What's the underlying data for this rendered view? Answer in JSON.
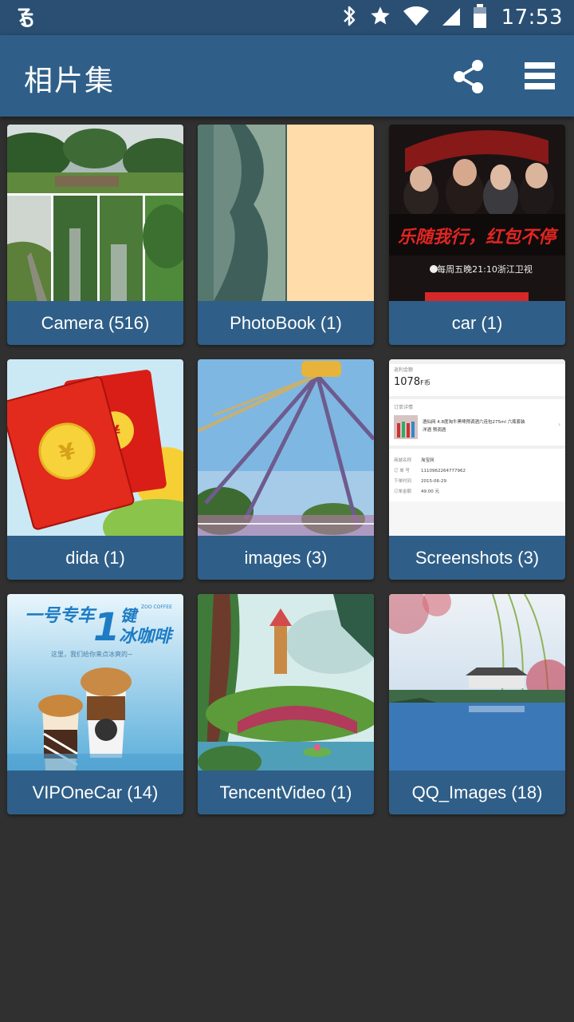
{
  "status_bar": {
    "time": "17:53",
    "icons": [
      "app-notification-icon",
      "bluetooth-icon",
      "star-icon",
      "wifi-icon",
      "signal-icon",
      "battery-icon"
    ]
  },
  "app_bar": {
    "title": "相片集",
    "actions": [
      "share-icon",
      "list-view-icon"
    ],
    "color": "#2f5f88"
  },
  "albums": [
    {
      "caption": "Camera (516)"
    },
    {
      "caption": "PhotoBook (1)"
    },
    {
      "caption": "car (1)",
      "thumb_text": {
        "banner": "乐随我行，红包不停",
        "sub": "每周五晚21:10浙江卫视"
      }
    },
    {
      "caption": "dida (1)"
    },
    {
      "caption": "images (3)"
    },
    {
      "caption": "Screenshots (3)",
      "thumb_text": {
        "label1": "返利金额",
        "amount": "1078",
        "amount_unit": "F币",
        "label2": "订单详情",
        "product": "酒仙网 4.8度淘牛黑啤预调酒六连包275ml 六瓶套装",
        "product2": "洋酒 预调酒",
        "rows": [
          [
            "商城名称",
            "淘宝网"
          ],
          [
            "订 单 号",
            "1110962264777962"
          ],
          [
            "下单时间",
            "2015-06-29"
          ],
          [
            "订单金额",
            "49.00 元"
          ]
        ]
      }
    },
    {
      "caption": "VIPOneCar (14)",
      "thumb_text": {
        "headline": "一号专车",
        "big": "1",
        "word": "键",
        "coffee": "冰咖啡",
        "brand": "ZOO COFFEE",
        "sub": "这里，我们给你来点冰爽的~"
      }
    },
    {
      "caption": "TencentVideo (1)"
    },
    {
      "caption": "QQ_Images (18)"
    }
  ]
}
